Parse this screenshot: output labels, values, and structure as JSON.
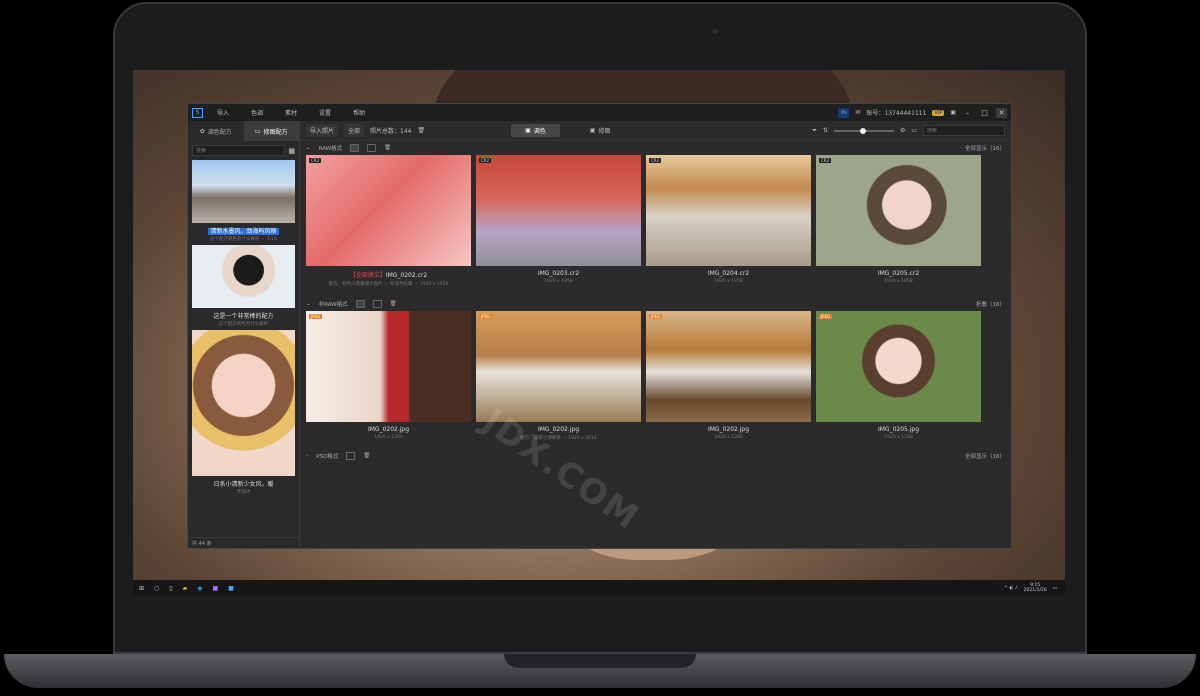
{
  "menu": [
    "导入",
    "色调",
    "素材",
    "设置",
    "帮助"
  ],
  "app_logo_text": "S",
  "account": {
    "label": "账号：13744441111",
    "vip": "VIP"
  },
  "ps_label": "Ps",
  "sidebar": {
    "tabs": [
      {
        "label": "调色配方"
      },
      {
        "label": "修图配方"
      }
    ],
    "search_placeholder": "搜索",
    "presets": [
      {
        "title": "清新水墨风，劲海屿风格",
        "sub": "这个配方调色有什么解析 ・ 1/10",
        "selected": true
      },
      {
        "title": "这是一个非常棒的配方",
        "sub": "这个配方调色有什么解析"
      },
      {
        "title": "日系小清新少女风，暖",
        "sub": "无描述"
      }
    ],
    "footer": "共 44 条"
  },
  "toolbar": {
    "import": "导入照片",
    "all": "全部",
    "count": "照片总数：144",
    "mode_color": "调色",
    "mode_retouch": "修图",
    "search_placeholder": "搜索"
  },
  "sections": [
    {
      "title": "RAW格式",
      "right": "全部显示（16）",
      "cards": [
        {
          "prefix": "【全部换文】",
          "name": "IMG_0202.cr2",
          "meta": "配方：和色人像暖调大图片 ・ 标准色彩集 ・ 1920 x 1958",
          "tag": "CR2"
        },
        {
          "name": "IMG_0203.cr2",
          "meta": "1920 x 1958",
          "tag": "CR2"
        },
        {
          "name": "IMG_0204.cr2",
          "meta": "1920 x 1958",
          "tag": "CR2"
        },
        {
          "name": "IMG_0205.cr2",
          "meta": "1920 x 1958",
          "tag": "CR2"
        }
      ]
    },
    {
      "title": "非RAW格式",
      "right": "折叠（16）",
      "cards": [
        {
          "name": "IMG_0202.jpg",
          "meta": "1920 x 1280",
          "tag": "JPEG"
        },
        {
          "name": "IMG_0202.jpg",
          "meta": "配方：日系小清新系 ・ 1920 x 2016",
          "tag": "JPEG"
        },
        {
          "name": "IMG_0202.jpg",
          "meta": "1920 x 1280",
          "tag": "JPEG"
        },
        {
          "name": "IMG_0205.jpg",
          "meta": "1920 x 1280",
          "tag": "JPEG"
        }
      ]
    },
    {
      "title": "PSD格式",
      "right": "全部显示（16）",
      "cards": []
    }
  ],
  "taskbar": {
    "time": "9:15",
    "date": "2021/1/26"
  },
  "watermark": "JDX.COM"
}
